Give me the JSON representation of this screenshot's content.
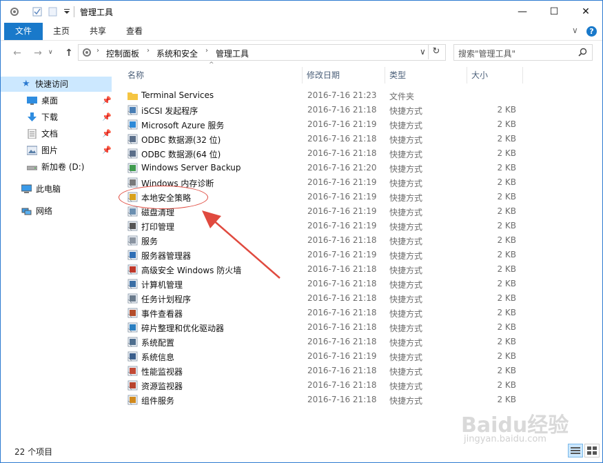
{
  "title_bar": {
    "title": "管理工具",
    "minimize_glyph": "—",
    "maximize_glyph": "☐",
    "close_glyph": "✕"
  },
  "ribbon": {
    "tabs": [
      {
        "label": "文件"
      },
      {
        "label": "主页"
      },
      {
        "label": "共享"
      },
      {
        "label": "查看"
      }
    ],
    "expand_glyph": "∨",
    "help_glyph": "?"
  },
  "address": {
    "breadcrumbs": [
      "控制面板",
      "系统和安全",
      "管理工具"
    ],
    "search_placeholder": "搜索\"管理工具\""
  },
  "nav_pane": {
    "quick_access": "快速访问",
    "items": [
      {
        "label": "桌面",
        "icon": "desktop-icon"
      },
      {
        "label": "下载",
        "icon": "download-icon"
      },
      {
        "label": "文档",
        "icon": "document-icon"
      },
      {
        "label": "图片",
        "icon": "picture-icon"
      },
      {
        "label": "新加卷 (D:)",
        "icon": "drive-icon"
      }
    ],
    "this_pc": "此电脑",
    "network": "网络"
  },
  "columns": {
    "name": "名称",
    "date": "修改日期",
    "type": "类型",
    "size": "大小"
  },
  "files": [
    {
      "name": "Terminal Services",
      "date": "2016-7-16 21:23",
      "type": "文件夹",
      "size": "",
      "icon": "folder-icon"
    },
    {
      "name": "iSCSI 发起程序",
      "date": "2016-7-16 21:18",
      "type": "快捷方式",
      "size": "2 KB",
      "icon": "iscsi-icon"
    },
    {
      "name": "Microsoft Azure 服务",
      "date": "2016-7-16 21:19",
      "type": "快捷方式",
      "size": "2 KB",
      "icon": "azure-icon"
    },
    {
      "name": "ODBC 数据源(32 位)",
      "date": "2016-7-16 21:18",
      "type": "快捷方式",
      "size": "2 KB",
      "icon": "odbc-icon"
    },
    {
      "name": "ODBC 数据源(64 位)",
      "date": "2016-7-16 21:18",
      "type": "快捷方式",
      "size": "2 KB",
      "icon": "odbc-icon"
    },
    {
      "name": "Windows Server Backup",
      "date": "2016-7-16 21:20",
      "type": "快捷方式",
      "size": "2 KB",
      "icon": "backup-icon"
    },
    {
      "name": "Windows 内存诊断",
      "date": "2016-7-16 21:19",
      "type": "快捷方式",
      "size": "2 KB",
      "icon": "memory-diagnostic-icon"
    },
    {
      "name": "本地安全策略",
      "date": "2016-7-16 21:19",
      "type": "快捷方式",
      "size": "2 KB",
      "icon": "security-policy-icon"
    },
    {
      "name": "磁盘清理",
      "date": "2016-7-16 21:19",
      "type": "快捷方式",
      "size": "2 KB",
      "icon": "disk-cleanup-icon"
    },
    {
      "name": "打印管理",
      "date": "2016-7-16 21:19",
      "type": "快捷方式",
      "size": "2 KB",
      "icon": "print-icon"
    },
    {
      "name": "服务",
      "date": "2016-7-16 21:18",
      "type": "快捷方式",
      "size": "2 KB",
      "icon": "services-icon"
    },
    {
      "name": "服务器管理器",
      "date": "2016-7-16 21:19",
      "type": "快捷方式",
      "size": "2 KB",
      "icon": "server-manager-icon"
    },
    {
      "name": "高级安全 Windows 防火墙",
      "date": "2016-7-16 21:18",
      "type": "快捷方式",
      "size": "2 KB",
      "icon": "firewall-icon"
    },
    {
      "name": "计算机管理",
      "date": "2016-7-16 21:18",
      "type": "快捷方式",
      "size": "2 KB",
      "icon": "computer-management-icon"
    },
    {
      "name": "任务计划程序",
      "date": "2016-7-16 21:18",
      "type": "快捷方式",
      "size": "2 KB",
      "icon": "task-scheduler-icon"
    },
    {
      "name": "事件查看器",
      "date": "2016-7-16 21:18",
      "type": "快捷方式",
      "size": "2 KB",
      "icon": "event-viewer-icon"
    },
    {
      "name": "碎片整理和优化驱动器",
      "date": "2016-7-16 21:18",
      "type": "快捷方式",
      "size": "2 KB",
      "icon": "defrag-icon"
    },
    {
      "name": "系统配置",
      "date": "2016-7-16 21:18",
      "type": "快捷方式",
      "size": "2 KB",
      "icon": "system-config-icon"
    },
    {
      "name": "系统信息",
      "date": "2016-7-16 21:19",
      "type": "快捷方式",
      "size": "2 KB",
      "icon": "system-info-icon"
    },
    {
      "name": "性能监视器",
      "date": "2016-7-16 21:18",
      "type": "快捷方式",
      "size": "2 KB",
      "icon": "performance-monitor-icon"
    },
    {
      "name": "资源监视器",
      "date": "2016-7-16 21:18",
      "type": "快捷方式",
      "size": "2 KB",
      "icon": "resource-monitor-icon"
    },
    {
      "name": "组件服务",
      "date": "2016-7-16 21:18",
      "type": "快捷方式",
      "size": "2 KB",
      "icon": "component-services-icon"
    }
  ],
  "status": {
    "item_count": "22 个项目"
  },
  "watermark": {
    "brand": "Baidu经验",
    "url": "jingyan.baidu.com"
  },
  "colors": {
    "file_tab": "#1979ca",
    "selected_nav": "#cce8ff",
    "annotation": "#e04a3f"
  }
}
